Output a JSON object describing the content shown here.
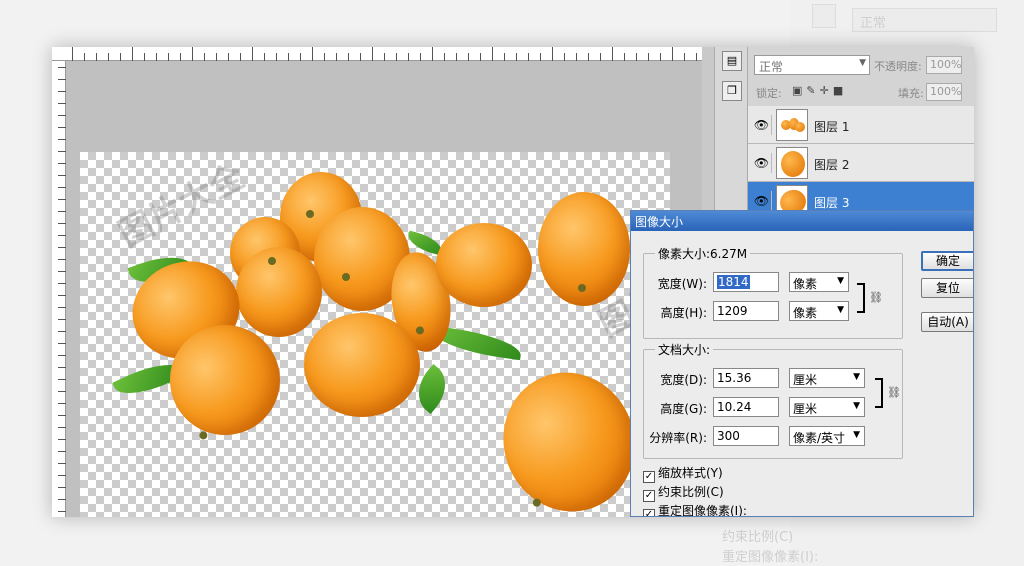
{
  "layers_panel": {
    "blend_mode": "正常",
    "opacity_label": "不透明度:",
    "opacity_value": "100%",
    "lock_label": "锁定:",
    "fill_label": "填充:",
    "fill_value": "100%",
    "layers": [
      {
        "name": "图层 1"
      },
      {
        "name": "图层 2"
      },
      {
        "name": "图层 3",
        "selected": true
      }
    ]
  },
  "dialog": {
    "title": "图像大小",
    "pixel_dimensions_label": "像素大小:6.27M",
    "px_width_label": "宽度(W):",
    "px_width_value": "1814",
    "px_width_unit": "像素",
    "px_height_label": "高度(H):",
    "px_height_value": "1209",
    "px_height_unit": "像素",
    "document_size_label": "文档大小:",
    "doc_width_label": "宽度(D):",
    "doc_width_value": "15.36",
    "doc_width_unit": "厘米",
    "doc_height_label": "高度(G):",
    "doc_height_value": "10.24",
    "doc_height_unit": "厘米",
    "resolution_label": "分辨率(R):",
    "resolution_value": "300",
    "resolution_unit": "像素/英寸",
    "ok_label": "确定",
    "reset_label": "复位",
    "auto_label": "自动(A)",
    "checkboxes": [
      {
        "label": "缩放样式(Y)",
        "checked": true
      },
      {
        "label": "约束比例(C)",
        "checked": true
      },
      {
        "label": "重定图像像素(I):",
        "checked": true
      }
    ]
  },
  "background_ghost": {
    "blend_mode": "正常",
    "constrain_label": "约束比例(C)",
    "resample_label": "重定图像像素(I):"
  },
  "colors": {
    "selection": "#3d7fd0",
    "dialog_title": "#2a64b8",
    "fruit": "#f79a1e"
  }
}
